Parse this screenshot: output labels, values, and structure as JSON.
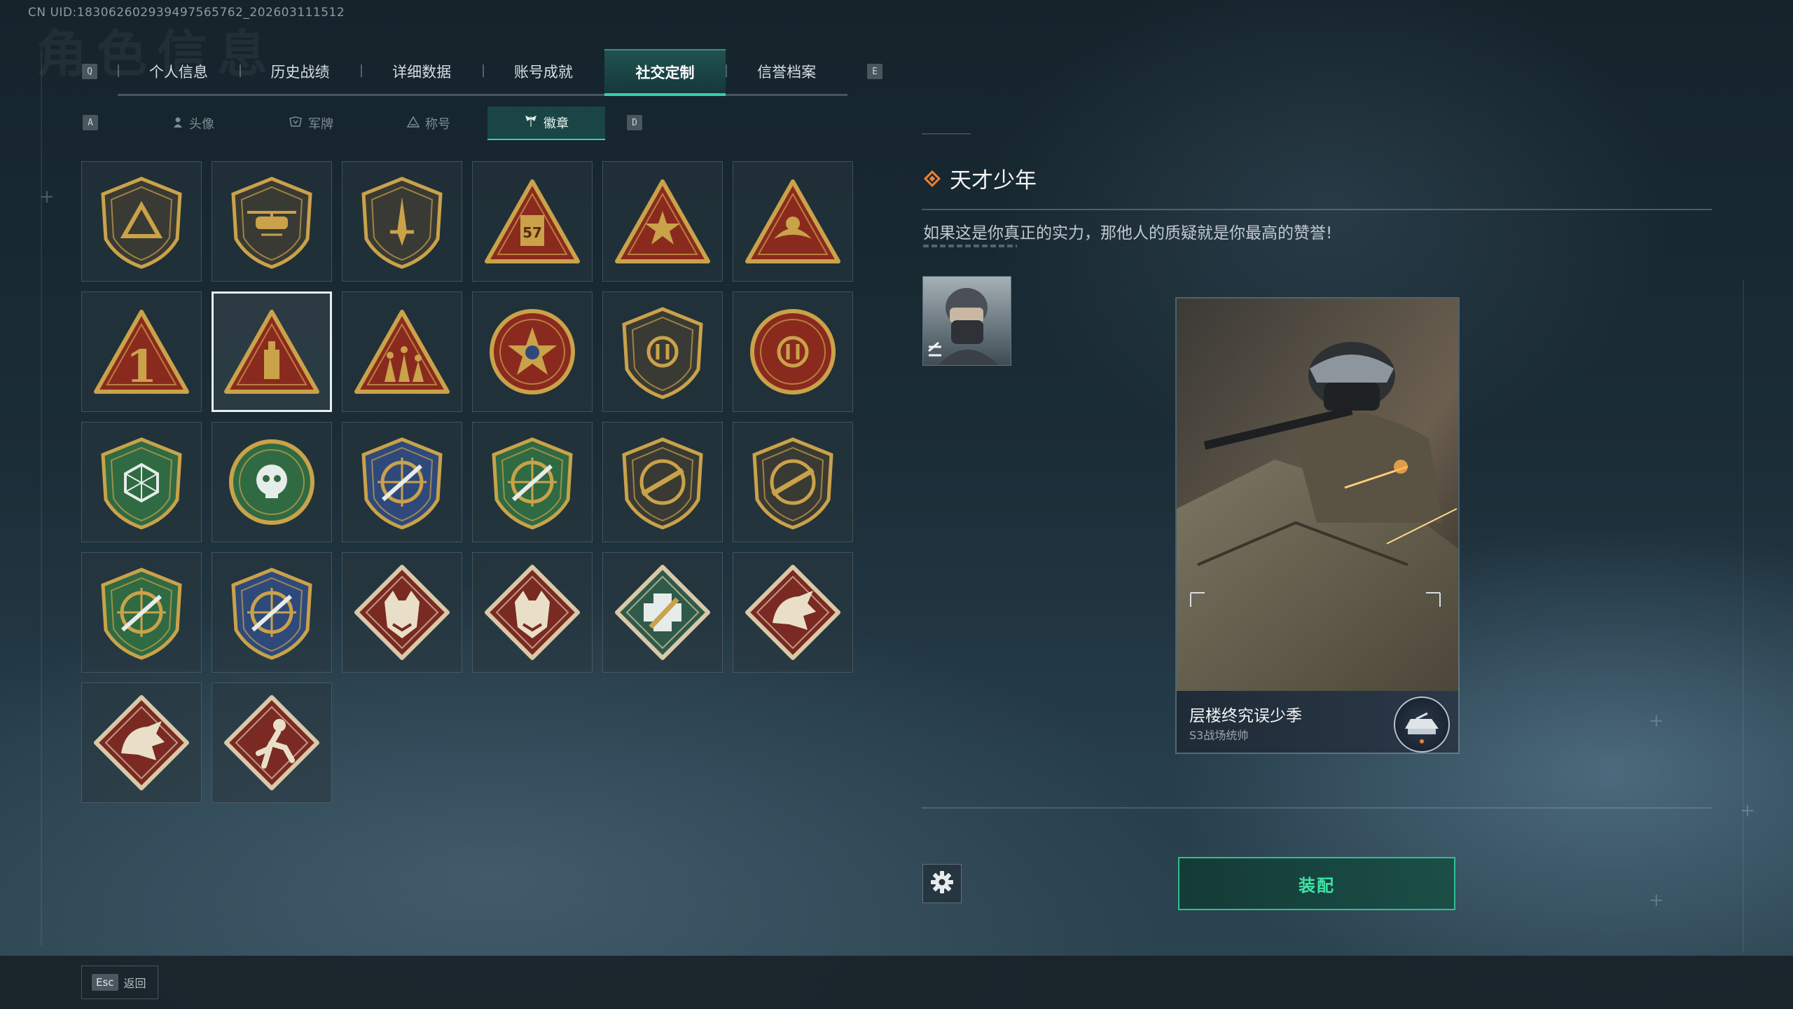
{
  "uid": "CN UID:183062602939497565762_202603111512",
  "background_title": "角色信息",
  "tabs": {
    "key_left": "Q",
    "key_right": "E",
    "items": [
      {
        "label": "个人信息"
      },
      {
        "label": "历史战绩"
      },
      {
        "label": "详细数据"
      },
      {
        "label": "账号成就"
      },
      {
        "label": "社交定制",
        "active": true
      },
      {
        "label": "信誉档案"
      }
    ]
  },
  "subtabs": {
    "key_left": "A",
    "key_right": "D",
    "items": [
      {
        "label": "头像",
        "icon": "person-icon"
      },
      {
        "label": "军牌",
        "icon": "dogtag-icon"
      },
      {
        "label": "称号",
        "icon": "title-icon"
      },
      {
        "label": "徽章",
        "icon": "badge-icon",
        "active": true
      }
    ]
  },
  "badges": [
    {
      "shape": "shield",
      "motif": "triangle",
      "color": "#3a3a34"
    },
    {
      "shape": "shield",
      "motif": "helicopter",
      "color": "#3a3a34"
    },
    {
      "shape": "shield",
      "motif": "dagger",
      "color": "#3a3a34"
    },
    {
      "shape": "triangle",
      "motif": "57",
      "color": "#8a2a1e"
    },
    {
      "shape": "triangle",
      "motif": "star",
      "color": "#8a2a1e"
    },
    {
      "shape": "triangle",
      "motif": "bird",
      "color": "#8a2a1e"
    },
    {
      "shape": "triangle",
      "motif": "1",
      "color": "#8a2a1e"
    },
    {
      "shape": "triangle",
      "motif": "tower",
      "color": "#8a2a1e",
      "selected": true
    },
    {
      "shape": "triangle",
      "motif": "soldiers",
      "color": "#8a2a1e"
    },
    {
      "shape": "round",
      "motif": "starburst",
      "color": "#8a2a1e"
    },
    {
      "shape": "shield",
      "motif": "emblem",
      "color": "#3a3a34"
    },
    {
      "shape": "round",
      "motif": "emblem",
      "color": "#8a2a1e"
    },
    {
      "shape": "shield",
      "motif": "hexagon",
      "color": "#2f6a43"
    },
    {
      "shape": "round",
      "motif": "skull",
      "color": "#2f6a43"
    },
    {
      "shape": "shield",
      "motif": "crosshair",
      "color": "#2f4a7a"
    },
    {
      "shape": "shield",
      "motif": "crosshair",
      "color": "#2f6a43"
    },
    {
      "shape": "shield",
      "motif": "rifle",
      "color": "#3a3a34"
    },
    {
      "shape": "shield",
      "motif": "rifle",
      "color": "#3a3a34"
    },
    {
      "shape": "shield",
      "motif": "crosshair",
      "color": "#2f6a43"
    },
    {
      "shape": "shield",
      "motif": "crosshair",
      "color": "#2f4a7a"
    },
    {
      "shape": "diamond",
      "motif": "wolf",
      "color": "#7a2a22"
    },
    {
      "shape": "diamond",
      "motif": "wolf",
      "color": "#7a2a22"
    },
    {
      "shape": "diamond",
      "motif": "medic",
      "color": "#2f5a4a"
    },
    {
      "shape": "diamond",
      "motif": "dragon",
      "color": "#7a2a22"
    },
    {
      "shape": "diamond",
      "motif": "dragon",
      "color": "#7a2a22"
    },
    {
      "shape": "diamond",
      "motif": "runner",
      "color": "#7a2a22"
    }
  ],
  "detail": {
    "title": "天才少年",
    "description": "如果这是你真正的实力，那他人的质疑就是你最高的赞誉!",
    "card_name": "层楼终究误少季",
    "card_sub": "S3战场统帅",
    "equip_label": "装配"
  },
  "footer": {
    "esc_key": "Esc",
    "esc_label": "返回"
  },
  "colors": {
    "accent": "#2fd2a9",
    "equip_text": "#3fe3a8",
    "gold": "#c9a24a"
  }
}
